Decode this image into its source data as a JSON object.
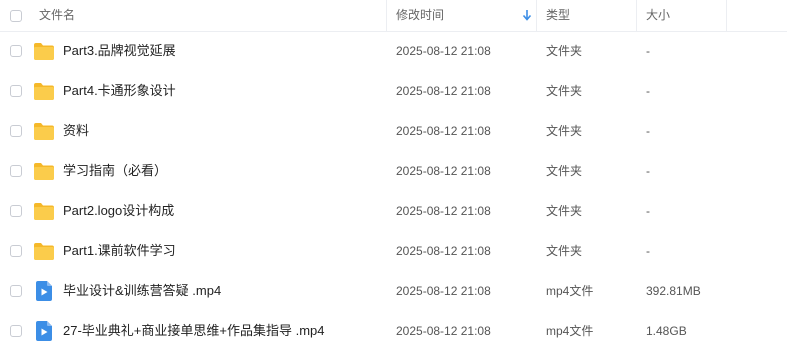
{
  "header": {
    "name": "文件名",
    "modified": "修改时间",
    "type": "类型",
    "size": "大小"
  },
  "colors": {
    "folder": "#f9c742",
    "video": "#3c8ee6",
    "sort_arrow": "#3c8ee6"
  },
  "files": [
    {
      "name": "Part3.品牌视觉延展",
      "modified": "2025-08-12 21:08",
      "type": "文件夹",
      "size": "-",
      "icon": "folder-icon"
    },
    {
      "name": "Part4.卡通形象设计",
      "modified": "2025-08-12 21:08",
      "type": "文件夹",
      "size": "-",
      "icon": "folder-icon"
    },
    {
      "name": "资料",
      "modified": "2025-08-12 21:08",
      "type": "文件夹",
      "size": "-",
      "icon": "folder-icon"
    },
    {
      "name": "学习指南（必看）",
      "modified": "2025-08-12 21:08",
      "type": "文件夹",
      "size": "-",
      "icon": "folder-icon"
    },
    {
      "name": "Part2.logo设计构成",
      "modified": "2025-08-12 21:08",
      "type": "文件夹",
      "size": "-",
      "icon": "folder-icon"
    },
    {
      "name": "Part1.课前软件学习",
      "modified": "2025-08-12 21:08",
      "type": "文件夹",
      "size": "-",
      "icon": "folder-icon"
    },
    {
      "name": "毕业设计&训练营答疑 .mp4",
      "modified": "2025-08-12 21:08",
      "type": "mp4文件",
      "size": "392.81MB",
      "icon": "video-file-icon"
    },
    {
      "name": "27-毕业典礼+商业接单思维+作品集指导 .mp4",
      "modified": "2025-08-12 21:08",
      "type": "mp4文件",
      "size": "1.48GB",
      "icon": "video-file-icon"
    }
  ]
}
